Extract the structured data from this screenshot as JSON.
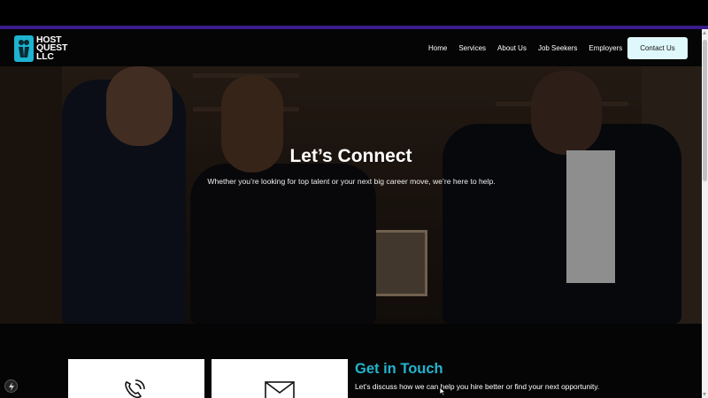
{
  "brand": {
    "logo_line1": "HOST",
    "logo_line2": "QUEST",
    "logo_line3": "LLC"
  },
  "nav": {
    "items": [
      {
        "label": "Home"
      },
      {
        "label": "Services"
      },
      {
        "label": "About Us"
      },
      {
        "label": "Job Seekers"
      },
      {
        "label": "Employers"
      }
    ],
    "cta_label": "Contact Us"
  },
  "hero": {
    "title": "Let’s Connect",
    "subtitle": "Whether you’re looking for top talent or your next big career move, we’re here to help."
  },
  "contact": {
    "title": "Get in Touch",
    "subtitle": "Let’s discuss how we can help you hire better or find your next opportunity."
  },
  "cards": [
    {
      "icon": "phone-icon"
    },
    {
      "icon": "envelope-icon"
    }
  ],
  "colors": {
    "accent": "#22b4cf",
    "cta_bg": "#dff8fb",
    "top_strip_line": "#3a1b8a",
    "page_bg": "#050505"
  }
}
